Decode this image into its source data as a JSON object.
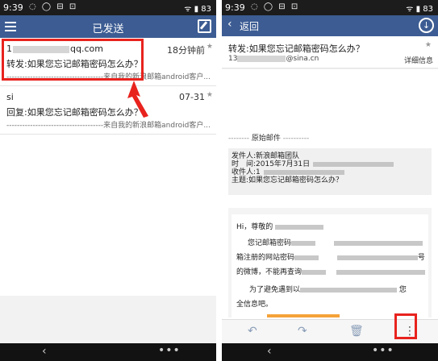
{
  "left": {
    "status": {
      "time": "9:39",
      "battery": "83"
    },
    "title": "已发送",
    "mails": [
      {
        "from_prefix": "1",
        "from_suffix": "qq.com",
        "time": "18分钟前",
        "subject": "转发:如果您忘记邮箱密码怎么办？",
        "preview": "-------------------------------------来自我的新浪邮箱android客户..."
      },
      {
        "from_prefix": "si",
        "from_suffix": "",
        "time": "07-31",
        "subject": "回复:如果您忘记邮箱密码怎么办？",
        "preview": "-------------------------------------来自我的新浪邮箱android客户..."
      }
    ]
  },
  "right": {
    "status": {
      "time": "9:39",
      "battery": "83"
    },
    "back_label": "返回",
    "subject": "转发:如果您忘记邮箱密码怎么办？",
    "address_prefix": "13",
    "address_suffix": "@sina.cn",
    "detail_label": "详细信息",
    "original_label": "原始邮件",
    "info": {
      "sender": "发件人:新浪邮箱团队",
      "time": "时　间:2015年7月31日",
      "recipient": "收件人:1",
      "subject": "主题:如果您忘记邮箱密码怎么办？"
    },
    "body_lines": [
      "Hi，尊敬的",
      "您记邮箱密码",
      "箱注册的网站密码",
      "号",
      "的微博，不能再查询",
      "为了避免遇到以",
      "您",
      "全信息吧。"
    ]
  },
  "colors": {
    "title_bar": "#3c5c93",
    "highlight": "#e8231e"
  }
}
